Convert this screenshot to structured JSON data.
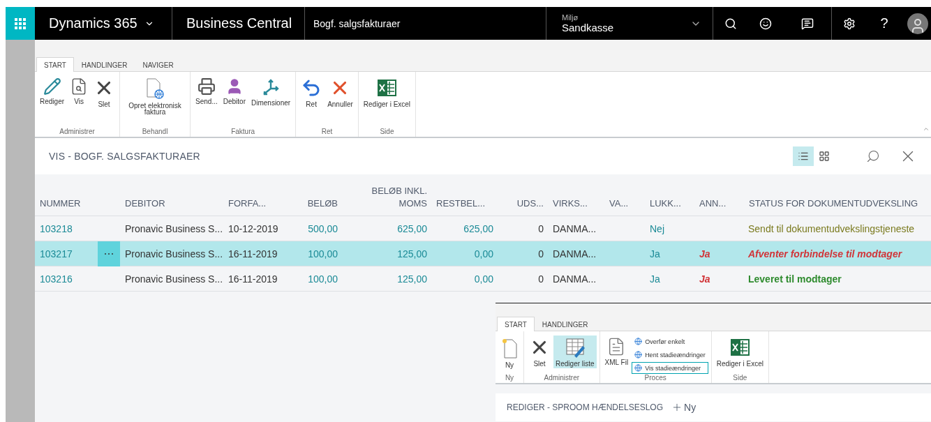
{
  "header": {
    "product": "Dynamics 365",
    "app": "Business Central",
    "page": "Bogf. salgsfakturaer",
    "environment_label": "Miljø",
    "environment": "Sandkasse",
    "help": "?"
  },
  "ribbon": {
    "tabs": [
      {
        "label": "START",
        "selected": true
      },
      {
        "label": "HANDLINGER",
        "selected": false
      },
      {
        "label": "NAVIGER",
        "selected": false
      }
    ],
    "groups": [
      {
        "label": "Administrer",
        "actions": [
          {
            "label": "Rediger",
            "kind": "edit"
          },
          {
            "label": "Vis",
            "kind": "view"
          },
          {
            "label": "Slet",
            "kind": "delete"
          }
        ]
      },
      {
        "label": "Behandl",
        "actions": [
          {
            "label": "Opret elektronisk faktura",
            "kind": "edoc"
          }
        ]
      },
      {
        "label": "Faktura",
        "actions": [
          {
            "label": "Send...",
            "kind": "send"
          },
          {
            "label": "Debitor",
            "kind": "person"
          },
          {
            "label": "Dimensioner",
            "kind": "dimensions"
          }
        ]
      },
      {
        "label": "Ret",
        "actions": [
          {
            "label": "Ret",
            "kind": "undo"
          },
          {
            "label": "Annuller",
            "kind": "cancel"
          }
        ]
      },
      {
        "label": "Side",
        "actions": [
          {
            "label": "Rediger i Excel",
            "kind": "excel"
          }
        ]
      }
    ]
  },
  "list": {
    "title": "VIS - BOGF. SALGSFAKTURAER",
    "views": [
      {
        "kind": "list",
        "selected": true
      },
      {
        "kind": "tiles",
        "selected": false
      }
    ],
    "columns": [
      "NUMMER",
      "DEBITOR",
      "FORFA...",
      "BELØB",
      "BELØB INKL. MOMS",
      "RESTBEL...",
      "UDS...",
      "VIRKS...",
      "VA...",
      "LUKK...",
      "ANN...",
      "STATUS FOR DOKUMENTUDVEKSLING"
    ],
    "rows": [
      {
        "selected": false,
        "number": "103218",
        "customer": "Pronavic Business S...",
        "due": "10-12-2019",
        "amount": "500,00",
        "amount_incl_vat": "625,00",
        "remaining": "625,00",
        "column_uds": "0",
        "column_virks": "DANMA...",
        "closed": "Nej",
        "cancelled": "",
        "status": {
          "text": "Sendt til dokumentudvekslingstjeneste",
          "kind": "plain",
          "color": "#7a7a1e"
        }
      },
      {
        "selected": true,
        "number": "103217",
        "customer": "Pronavic Business S...",
        "due": "16-11-2019",
        "amount": "100,00",
        "amount_incl_vat": "125,00",
        "remaining": "0,00",
        "column_uds": "0",
        "column_virks": "DANMA...",
        "closed": "Ja",
        "cancelled": "Ja",
        "status": {
          "text": "Afventer forbindelse til modtager",
          "kind": "bold-italic",
          "color": "#d13438"
        }
      },
      {
        "selected": false,
        "number": "103216",
        "customer": "Pronavic Business S...",
        "due": "16-11-2019",
        "amount": "100,00",
        "amount_incl_vat": "125,00",
        "remaining": "0,00",
        "column_uds": "0",
        "column_virks": "DANMA...",
        "closed": "Ja",
        "cancelled": "Ja",
        "status": {
          "text": "Leveret til modtager",
          "kind": "bold",
          "color": "#2e8b2e"
        }
      }
    ]
  },
  "log_window": {
    "tabs": [
      {
        "label": "START",
        "selected": true
      },
      {
        "label": "HANDLINGER",
        "selected": false
      }
    ],
    "groups": [
      {
        "label": "Ny",
        "actions": [
          {
            "label": "Ny",
            "kind": "new",
            "selected": false
          }
        ]
      },
      {
        "label": "Administrer",
        "actions": [
          {
            "label": "Slet",
            "kind": "delete",
            "selected": false
          },
          {
            "label": "Rediger liste",
            "kind": "editlist",
            "selected": true
          }
        ]
      },
      {
        "label": "Proces",
        "actions": [
          {
            "label": "XML Fil",
            "kind": "xml",
            "selected": false
          }
        ],
        "small_actions": [
          {
            "label": "Overfør enkelt",
            "focused": false
          },
          {
            "label": "Hent stadieændringer",
            "focused": false
          },
          {
            "label": "Vis stadieændringer",
            "focused": true
          }
        ]
      },
      {
        "label": "Side",
        "actions": [
          {
            "label": "Rediger i Excel",
            "kind": "excel",
            "selected": false
          }
        ]
      }
    ],
    "title": "REDIGER - SPROOM HÆNDELSESLOG",
    "new_button": "Ny"
  }
}
